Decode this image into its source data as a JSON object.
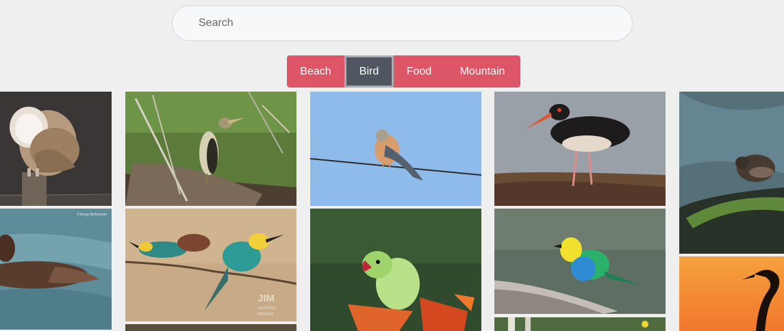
{
  "search": {
    "placeholder": "Search"
  },
  "categories": {
    "beach": "Beach",
    "bird": "Bird",
    "food": "Food",
    "mountain": "Mountain",
    "active": "Bird"
  },
  "colors": {
    "page_background": "#efefef",
    "button": "#dc5667",
    "button_active": "#505660",
    "button_text": "#ffffff"
  },
  "gallery": {
    "category": "Bird",
    "images": [
      {
        "subject": "barn owl on post",
        "icon": "barn-owl-photo"
      },
      {
        "subject": "duck swimming",
        "icon": "duck-photo"
      },
      {
        "subject": "heron in reeds",
        "icon": "heron-photo"
      },
      {
        "subject": "bee-eaters on branch",
        "icon": "bee-eater-photo"
      },
      {
        "subject": "kestrel on wire",
        "icon": "kestrel-photo"
      },
      {
        "subject": "parakeet on flower",
        "icon": "parakeet-photo"
      },
      {
        "subject": "oystercatcher on rock",
        "icon": "oystercatcher-photo"
      },
      {
        "subject": "tanager on branch",
        "icon": "tanager-photo"
      },
      {
        "subject": "dipper on mossy rock",
        "icon": "dipper-photo"
      },
      {
        "subject": "heron silhouette at sunset",
        "icon": "heron-silhouette-photo"
      }
    ],
    "watermarks": {
      "duck": "©Doug Robertson",
      "bee_eater_line1": "JIM",
      "bee_eater_line2": "Juancho",
      "bee_eater_line3": "Medina"
    }
  }
}
